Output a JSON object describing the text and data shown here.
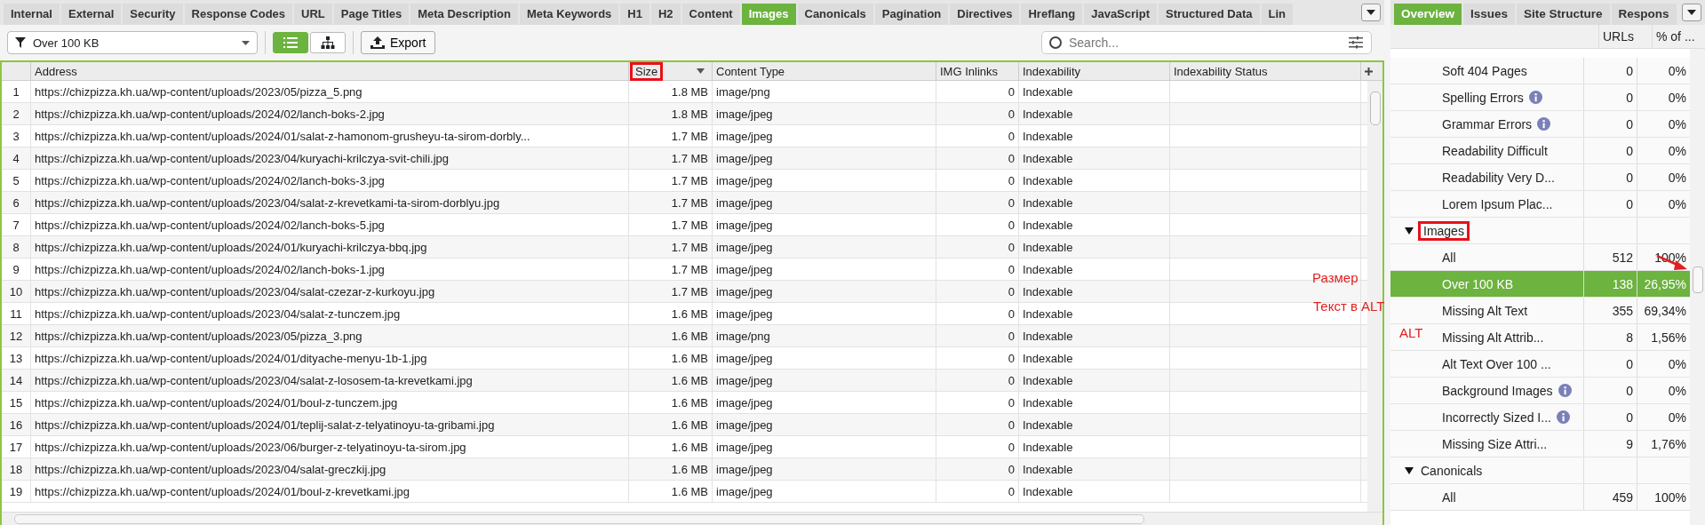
{
  "main_tabs": [
    {
      "label": "Internal",
      "selected": false
    },
    {
      "label": "External",
      "selected": false
    },
    {
      "label": "Security",
      "selected": false
    },
    {
      "label": "Response Codes",
      "selected": false
    },
    {
      "label": "URL",
      "selected": false
    },
    {
      "label": "Page Titles",
      "selected": false
    },
    {
      "label": "Meta Description",
      "selected": false
    },
    {
      "label": "Meta Keywords",
      "selected": false
    },
    {
      "label": "H1",
      "selected": false
    },
    {
      "label": "H2",
      "selected": false
    },
    {
      "label": "Content",
      "selected": false
    },
    {
      "label": "Images",
      "selected": true
    },
    {
      "label": "Canonicals",
      "selected": false
    },
    {
      "label": "Pagination",
      "selected": false
    },
    {
      "label": "Directives",
      "selected": false
    },
    {
      "label": "Hreflang",
      "selected": false
    },
    {
      "label": "JavaScript",
      "selected": false
    },
    {
      "label": "Structured Data",
      "selected": false
    },
    {
      "label": "Lin",
      "selected": false
    }
  ],
  "toolbar": {
    "filter": "Over 100 KB",
    "view_buttons": [
      {
        "kind": "list",
        "selected": true
      },
      {
        "kind": "tree",
        "selected": false
      }
    ],
    "export": "Export",
    "search": {
      "placeholder": "Search..."
    }
  },
  "table": {
    "columns": [
      {
        "label": "Address",
        "highlighted": false,
        "sorted": false
      },
      {
        "label": "Size",
        "highlighted": true,
        "sorted": true
      },
      {
        "label": "Content Type",
        "highlighted": false,
        "sorted": false
      },
      {
        "label": "IMG Inlinks",
        "highlighted": false,
        "sorted": false
      },
      {
        "label": "Indexability",
        "highlighted": false,
        "sorted": false
      },
      {
        "label": "Indexability Status",
        "highlighted": false,
        "sorted": false
      }
    ],
    "rows": [
      {
        "num": "1",
        "address": "https://chizpizza.kh.ua/wp-content/uploads/2023/05/pizza_5.png",
        "size": "1.8 MB",
        "content_type": "image/png",
        "img_inlinks": "0",
        "indexability": "Indexable"
      },
      {
        "num": "2",
        "address": "https://chizpizza.kh.ua/wp-content/uploads/2024/02/lanch-boks-2.jpg",
        "size": "1.8 MB",
        "content_type": "image/jpeg",
        "img_inlinks": "0",
        "indexability": "Indexable"
      },
      {
        "num": "3",
        "address": "https://chizpizza.kh.ua/wp-content/uploads/2024/01/salat-z-hamonom-grusheyu-ta-sirom-dorbly...",
        "size": "1.7 MB",
        "content_type": "image/jpeg",
        "img_inlinks": "0",
        "indexability": "Indexable"
      },
      {
        "num": "4",
        "address": "https://chizpizza.kh.ua/wp-content/uploads/2023/04/kuryachi-krilczya-svit-chili.jpg",
        "size": "1.7 MB",
        "content_type": "image/jpeg",
        "img_inlinks": "0",
        "indexability": "Indexable"
      },
      {
        "num": "5",
        "address": "https://chizpizza.kh.ua/wp-content/uploads/2024/02/lanch-boks-3.jpg",
        "size": "1.7 MB",
        "content_type": "image/jpeg",
        "img_inlinks": "0",
        "indexability": "Indexable"
      },
      {
        "num": "6",
        "address": "https://chizpizza.kh.ua/wp-content/uploads/2023/04/salat-z-krevetkami-ta-sirom-dorblyu.jpg",
        "size": "1.7 MB",
        "content_type": "image/jpeg",
        "img_inlinks": "0",
        "indexability": "Indexable"
      },
      {
        "num": "7",
        "address": "https://chizpizza.kh.ua/wp-content/uploads/2024/02/lanch-boks-5.jpg",
        "size": "1.7 MB",
        "content_type": "image/jpeg",
        "img_inlinks": "0",
        "indexability": "Indexable"
      },
      {
        "num": "8",
        "address": "https://chizpizza.kh.ua/wp-content/uploads/2024/01/kuryachi-krilczya-bbq.jpg",
        "size": "1.7 MB",
        "content_type": "image/jpeg",
        "img_inlinks": "0",
        "indexability": "Indexable"
      },
      {
        "num": "9",
        "address": "https://chizpizza.kh.ua/wp-content/uploads/2024/02/lanch-boks-1.jpg",
        "size": "1.7 MB",
        "content_type": "image/jpeg",
        "img_inlinks": "0",
        "indexability": "Indexable"
      },
      {
        "num": "10",
        "address": "https://chizpizza.kh.ua/wp-content/uploads/2023/04/salat-czezar-z-kurkoyu.jpg",
        "size": "1.7 MB",
        "content_type": "image/jpeg",
        "img_inlinks": "0",
        "indexability": "Indexable"
      },
      {
        "num": "11",
        "address": "https://chizpizza.kh.ua/wp-content/uploads/2023/04/salat-z-tunczem.jpg",
        "size": "1.6 MB",
        "content_type": "image/jpeg",
        "img_inlinks": "0",
        "indexability": "Indexable"
      },
      {
        "num": "12",
        "address": "https://chizpizza.kh.ua/wp-content/uploads/2023/05/pizza_3.png",
        "size": "1.6 MB",
        "content_type": "image/png",
        "img_inlinks": "0",
        "indexability": "Indexable"
      },
      {
        "num": "13",
        "address": "https://chizpizza.kh.ua/wp-content/uploads/2024/01/dityache-menyu-1b-1.jpg",
        "size": "1.6 MB",
        "content_type": "image/jpeg",
        "img_inlinks": "0",
        "indexability": "Indexable"
      },
      {
        "num": "14",
        "address": "https://chizpizza.kh.ua/wp-content/uploads/2023/04/salat-z-lososem-ta-krevetkami.jpg",
        "size": "1.6 MB",
        "content_type": "image/jpeg",
        "img_inlinks": "0",
        "indexability": "Indexable"
      },
      {
        "num": "15",
        "address": "https://chizpizza.kh.ua/wp-content/uploads/2024/01/boul-z-tunczem.jpg",
        "size": "1.6 MB",
        "content_type": "image/jpeg",
        "img_inlinks": "0",
        "indexability": "Indexable"
      },
      {
        "num": "16",
        "address": "https://chizpizza.kh.ua/wp-content/uploads/2024/01/teplij-salat-z-telyatinoyu-ta-gribami.jpg",
        "size": "1.6 MB",
        "content_type": "image/jpeg",
        "img_inlinks": "0",
        "indexability": "Indexable"
      },
      {
        "num": "17",
        "address": "https://chizpizza.kh.ua/wp-content/uploads/2023/06/burger-z-telyatinoyu-ta-sirom.jpg",
        "size": "1.6 MB",
        "content_type": "image/jpeg",
        "img_inlinks": "0",
        "indexability": "Indexable"
      },
      {
        "num": "18",
        "address": "https://chizpizza.kh.ua/wp-content/uploads/2023/04/salat-greczkij.jpg",
        "size": "1.6 MB",
        "content_type": "image/jpeg",
        "img_inlinks": "0",
        "indexability": "Indexable"
      },
      {
        "num": "19",
        "address": "https://chizpizza.kh.ua/wp-content/uploads/2024/01/boul-z-krevetkami.jpg",
        "size": "1.6 MB",
        "content_type": "image/jpeg",
        "img_inlinks": "0",
        "indexability": "Indexable"
      }
    ]
  },
  "side_tabs": [
    {
      "label": "Overview",
      "selected": true
    },
    {
      "label": "Issues",
      "selected": false
    },
    {
      "label": "Site Structure",
      "selected": false
    },
    {
      "label": "Respons",
      "selected": false
    }
  ],
  "overview": {
    "columns": [
      "URLs",
      "% of ..."
    ],
    "sections": [
      {
        "children": [
          {
            "label": "Soft 404 Pages",
            "info": false,
            "selected": false,
            "urls": "0",
            "percent": "0%"
          },
          {
            "label": "Spelling Errors",
            "info": true,
            "selected": false,
            "urls": "0",
            "percent": "0%"
          },
          {
            "label": "Grammar Errors",
            "info": true,
            "selected": false,
            "urls": "0",
            "percent": "0%"
          },
          {
            "label": "Readability Difficult",
            "info": false,
            "selected": false,
            "urls": "0",
            "percent": "0%"
          },
          {
            "label": "Readability Very D...",
            "info": false,
            "selected": false,
            "urls": "0",
            "percent": "0%"
          },
          {
            "label": "Lorem Ipsum Plac...",
            "info": false,
            "selected": false,
            "urls": "0",
            "percent": "0%"
          }
        ]
      },
      {
        "label": "Images",
        "expanded": true,
        "highlighted": true,
        "children": [
          {
            "label": "All",
            "info": false,
            "selected": false,
            "urls": "512",
            "percent": "100%"
          },
          {
            "label": "Over 100 KB",
            "info": false,
            "selected": true,
            "urls": "138",
            "percent": "26,95%"
          },
          {
            "label": "Missing Alt Text",
            "info": false,
            "selected": false,
            "urls": "355",
            "percent": "69,34%"
          },
          {
            "label": "Missing Alt Attrib...",
            "info": false,
            "selected": false,
            "urls": "8",
            "percent": "1,56%"
          },
          {
            "label": "Alt Text Over 100 ...",
            "info": false,
            "selected": false,
            "urls": "0",
            "percent": "0%"
          },
          {
            "label": "Background Images",
            "info": true,
            "selected": false,
            "urls": "0",
            "percent": "0%"
          },
          {
            "label": "Incorrectly Sized I...",
            "info": true,
            "selected": false,
            "urls": "0",
            "percent": "0%"
          },
          {
            "label": "Missing Size Attri...",
            "info": false,
            "selected": false,
            "urls": "9",
            "percent": "1,76%"
          }
        ]
      },
      {
        "label": "Canonicals",
        "expanded": true,
        "highlighted": false,
        "children": [
          {
            "label": "All",
            "info": false,
            "selected": false,
            "urls": "459",
            "percent": "100%"
          }
        ]
      }
    ]
  },
  "annotations": [
    {
      "text": "Размер"
    },
    {
      "text": "Текст в ALT"
    },
    {
      "text": "ALT"
    }
  ]
}
